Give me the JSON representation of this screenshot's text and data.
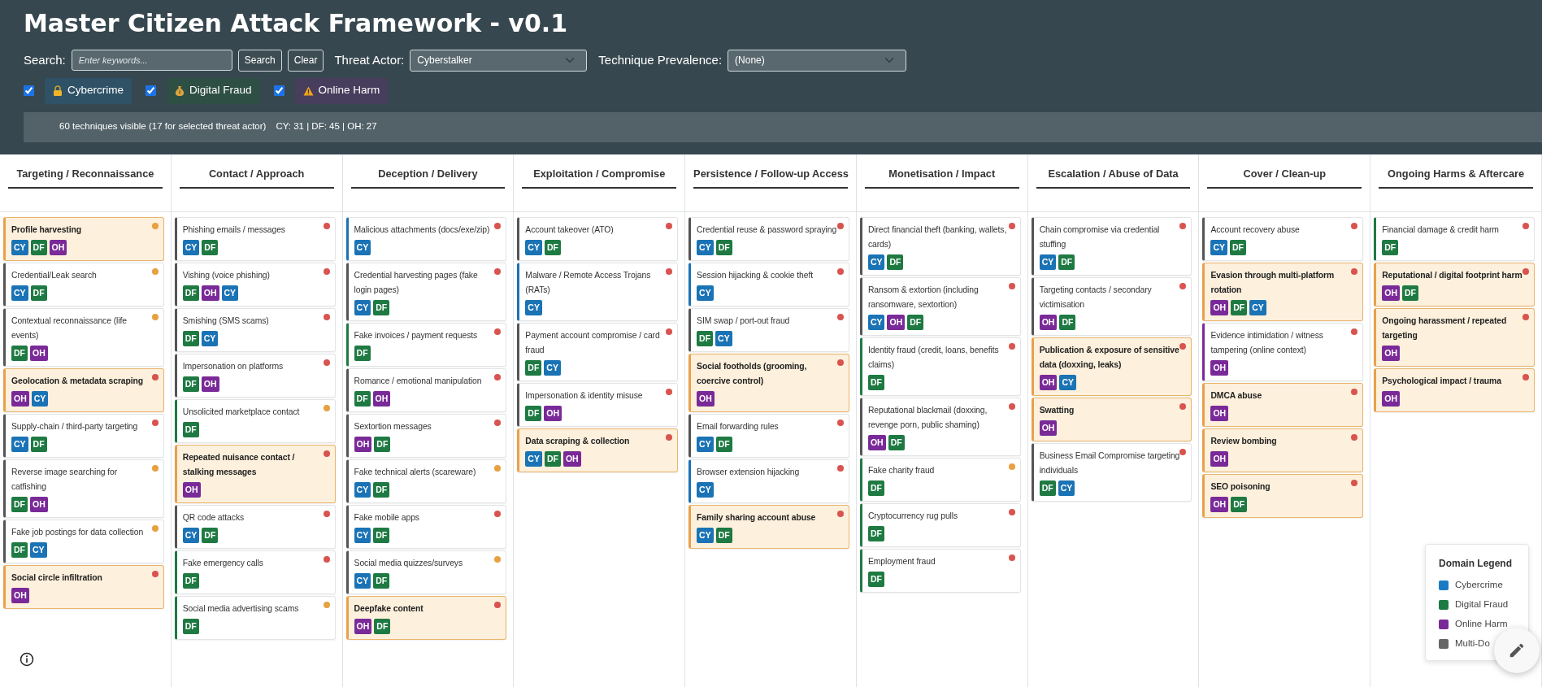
{
  "title": "Master Citizen Attack Framework - v0.1",
  "search": {
    "label": "Search:",
    "placeholder": "Enter keywords...",
    "buttons": [
      "Search",
      "Clear"
    ]
  },
  "threat_actor": {
    "label": "Threat Actor:",
    "value": "Cyberstalker"
  },
  "prevalence": {
    "label": "Technique Prevalence:",
    "value": "(None)"
  },
  "domain_filters": [
    {
      "label": "Cybercrime",
      "checked": true,
      "kind": "lock"
    },
    {
      "label": "Digital Fraud",
      "checked": true,
      "kind": "money"
    },
    {
      "label": "Online Harm",
      "checked": true,
      "kind": "warning"
    }
  ],
  "status_bar": {
    "summary": "60 techniques visible (17 for selected threat actor)",
    "counts": "CY: 31 | DF: 45 | OH: 27"
  },
  "columns": [
    {
      "title": "Targeting / Reconnaissance",
      "cards": [
        {
          "name": "Profile harvesting",
          "highlighted": true,
          "color": "#e8a040",
          "tags": [
            {
              "label": "CY",
              "color": "#1a73b5"
            },
            {
              "label": "DF",
              "color": "#1e7a42"
            },
            {
              "label": "OH",
              "color": "#7a2a98"
            }
          ]
        },
        {
          "name": "Credential/Leak search",
          "highlighted": false,
          "color": "#e8a040",
          "tags": [
            {
              "label": "CY",
              "color": "#1a73b5"
            },
            {
              "label": "DF",
              "color": "#1e7a42"
            }
          ]
        },
        {
          "name": "Contextual reconnaissance (life events)",
          "highlighted": false,
          "color": "#e8a040",
          "tags": [
            {
              "label": "DF",
              "color": "#1e7a42"
            },
            {
              "label": "OH",
              "color": "#7a2a98"
            }
          ]
        },
        {
          "name": "Geolocation & metadata scraping",
          "highlighted": true,
          "color": "#d9534f",
          "tags": [
            {
              "label": "OH",
              "color": "#7a2a98"
            },
            {
              "label": "CY",
              "color": "#1a73b5"
            }
          ]
        },
        {
          "name": "Supply-chain / third-party targeting",
          "highlighted": false,
          "color": "#d9534f",
          "tags": [
            {
              "label": "CY",
              "color": "#1a73b5"
            },
            {
              "label": "DF",
              "color": "#1e7a42"
            }
          ]
        },
        {
          "name": "Reverse image searching for catfishing",
          "highlighted": false,
          "color": "#e8a040",
          "tags": [
            {
              "label": "DF",
              "color": "#1e7a42"
            },
            {
              "label": "OH",
              "color": "#7a2a98"
            }
          ]
        },
        {
          "name": "Fake job postings for data collection",
          "highlighted": false,
          "color": "#e8a040",
          "tags": [
            {
              "label": "DF",
              "color": "#1e7a42"
            },
            {
              "label": "CY",
              "color": "#1a73b5"
            }
          ]
        },
        {
          "name": "Social circle infiltration",
          "highlighted": true,
          "color": "#d9534f",
          "tags": [
            {
              "label": "OH",
              "color": "#7a2a98"
            }
          ]
        }
      ]
    },
    {
      "title": "Contact / Approach",
      "cards": [
        {
          "name": "Phishing emails / messages",
          "highlighted": false,
          "color": "#d9534f",
          "tags": [
            {
              "label": "CY",
              "color": "#1a73b5"
            },
            {
              "label": "DF",
              "color": "#1e7a42"
            }
          ]
        },
        {
          "name": "Vishing (voice phishing)",
          "highlighted": false,
          "color": "#d9534f",
          "tags": [
            {
              "label": "DF",
              "color": "#1e7a42"
            },
            {
              "label": "OH",
              "color": "#7a2a98"
            },
            {
              "label": "CY",
              "color": "#1a73b5"
            }
          ]
        },
        {
          "name": "Smishing (SMS scams)",
          "highlighted": false,
          "color": "#d9534f",
          "tags": [
            {
              "label": "DF",
              "color": "#1e7a42"
            },
            {
              "label": "CY",
              "color": "#1a73b5"
            }
          ]
        },
        {
          "name": "Impersonation on platforms",
          "highlighted": false,
          "color": "#d9534f",
          "tags": [
            {
              "label": "DF",
              "color": "#1e7a42"
            },
            {
              "label": "OH",
              "color": "#7a2a98"
            }
          ]
        },
        {
          "name": "Unsolicited marketplace contact",
          "highlighted": false,
          "color": "#e8a040",
          "tags": [
            {
              "label": "DF",
              "color": "#1e7a42"
            }
          ]
        },
        {
          "name": "Repeated nuisance contact / stalking messages",
          "highlighted": true,
          "color": "#d9534f",
          "tags": [
            {
              "label": "OH",
              "color": "#7a2a98"
            }
          ]
        },
        {
          "name": "QR code attacks",
          "highlighted": false,
          "color": "#d9534f",
          "tags": [
            {
              "label": "CY",
              "color": "#1a73b5"
            },
            {
              "label": "DF",
              "color": "#1e7a42"
            }
          ]
        },
        {
          "name": "Fake emergency calls",
          "highlighted": false,
          "color": "#d9534f",
          "tags": [
            {
              "label": "DF",
              "color": "#1e7a42"
            }
          ]
        },
        {
          "name": "Social media advertising scams",
          "highlighted": false,
          "color": "#e8a040",
          "tags": [
            {
              "label": "DF",
              "color": "#1e7a42"
            }
          ]
        }
      ]
    },
    {
      "title": "Deception / Delivery",
      "cards": [
        {
          "name": "Malicious attachments (docs/exe/zip)",
          "highlighted": false,
          "color": "#d9534f",
          "tags": [
            {
              "label": "CY",
              "color": "#1a73b5"
            }
          ]
        },
        {
          "name": "Credential harvesting pages (fake login pages)",
          "highlighted": false,
          "color": "#d9534f",
          "tags": [
            {
              "label": "CY",
              "color": "#1a73b5"
            },
            {
              "label": "DF",
              "color": "#1e7a42"
            }
          ]
        },
        {
          "name": "Fake invoices / payment requests",
          "highlighted": false,
          "color": "#d9534f",
          "tags": [
            {
              "label": "DF",
              "color": "#1e7a42"
            }
          ]
        },
        {
          "name": "Romance / emotional manipulation",
          "highlighted": false,
          "color": "#d9534f",
          "tags": [
            {
              "label": "DF",
              "color": "#1e7a42"
            },
            {
              "label": "OH",
              "color": "#7a2a98"
            }
          ]
        },
        {
          "name": "Sextortion messages",
          "highlighted": false,
          "color": "#d9534f",
          "tags": [
            {
              "label": "OH",
              "color": "#7a2a98"
            },
            {
              "label": "DF",
              "color": "#1e7a42"
            }
          ]
        },
        {
          "name": "Fake technical alerts (scareware)",
          "highlighted": false,
          "color": "#e8a040",
          "tags": [
            {
              "label": "CY",
              "color": "#1a73b5"
            },
            {
              "label": "DF",
              "color": "#1e7a42"
            }
          ]
        },
        {
          "name": "Fake mobile apps",
          "highlighted": false,
          "color": "#d9534f",
          "tags": [
            {
              "label": "CY",
              "color": "#1a73b5"
            },
            {
              "label": "DF",
              "color": "#1e7a42"
            }
          ]
        },
        {
          "name": "Social media quizzes/surveys",
          "highlighted": false,
          "color": "#e8a040",
          "tags": [
            {
              "label": "CY",
              "color": "#1a73b5"
            },
            {
              "label": "DF",
              "color": "#1e7a42"
            }
          ]
        },
        {
          "name": "Deepfake content",
          "highlighted": true,
          "color": "#d9534f",
          "tags": [
            {
              "label": "OH",
              "color": "#7a2a98"
            },
            {
              "label": "DF",
              "color": "#1e7a42"
            }
          ]
        }
      ]
    },
    {
      "title": "Exploitation / Compromise",
      "cards": [
        {
          "name": "Account takeover (ATO)",
          "highlighted": false,
          "color": "#d9534f",
          "tags": [
            {
              "label": "CY",
              "color": "#1a73b5"
            },
            {
              "label": "DF",
              "color": "#1e7a42"
            }
          ]
        },
        {
          "name": "Malware / Remote Access Trojans (RATs)",
          "highlighted": false,
          "color": "#d9534f",
          "tags": [
            {
              "label": "CY",
              "color": "#1a73b5"
            }
          ]
        },
        {
          "name": "Payment account compromise / card fraud",
          "highlighted": false,
          "color": "#d9534f",
          "tags": [
            {
              "label": "DF",
              "color": "#1e7a42"
            },
            {
              "label": "CY",
              "color": "#1a73b5"
            }
          ]
        },
        {
          "name": "Impersonation & identity misuse",
          "highlighted": false,
          "color": "#d9534f",
          "tags": [
            {
              "label": "DF",
              "color": "#1e7a42"
            },
            {
              "label": "OH",
              "color": "#7a2a98"
            }
          ]
        },
        {
          "name": "Data scraping & collection",
          "highlighted": true,
          "color": "#d9534f",
          "tags": [
            {
              "label": "CY",
              "color": "#1a73b5"
            },
            {
              "label": "DF",
              "color": "#1e7a42"
            },
            {
              "label": "OH",
              "color": "#7a2a98"
            }
          ]
        }
      ]
    },
    {
      "title": "Persistence / Follow-up Access",
      "cards": [
        {
          "name": "Credential reuse & password spraying",
          "highlighted": false,
          "color": "#d9534f",
          "tags": [
            {
              "label": "CY",
              "color": "#1a73b5"
            },
            {
              "label": "DF",
              "color": "#1e7a42"
            }
          ]
        },
        {
          "name": "Session hijacking & cookie theft",
          "highlighted": false,
          "color": "#d9534f",
          "tags": [
            {
              "label": "CY",
              "color": "#1a73b5"
            }
          ]
        },
        {
          "name": "SIM swap / port-out fraud",
          "highlighted": false,
          "color": "#d9534f",
          "tags": [
            {
              "label": "DF",
              "color": "#1e7a42"
            },
            {
              "label": "CY",
              "color": "#1a73b5"
            }
          ]
        },
        {
          "name": "Social footholds (grooming, coercive control)",
          "highlighted": true,
          "color": "#d9534f",
          "tags": [
            {
              "label": "OH",
              "color": "#7a2a98"
            }
          ]
        },
        {
          "name": "Email forwarding rules",
          "highlighted": false,
          "color": "#d9534f",
          "tags": [
            {
              "label": "CY",
              "color": "#1a73b5"
            },
            {
              "label": "DF",
              "color": "#1e7a42"
            }
          ]
        },
        {
          "name": "Browser extension hijacking",
          "highlighted": false,
          "color": "#d9534f",
          "tags": [
            {
              "label": "CY",
              "color": "#1a73b5"
            }
          ]
        },
        {
          "name": "Family sharing account abuse",
          "highlighted": true,
          "color": "#d9534f",
          "tags": [
            {
              "label": "CY",
              "color": "#1a73b5"
            },
            {
              "label": "DF",
              "color": "#1e7a42"
            }
          ]
        }
      ]
    },
    {
      "title": "Monetisation / Impact",
      "cards": [
        {
          "name": "Direct financial theft (banking, wallets, cards)",
          "highlighted": false,
          "color": "#d9534f",
          "tags": [
            {
              "label": "CY",
              "color": "#1a73b5"
            },
            {
              "label": "DF",
              "color": "#1e7a42"
            }
          ]
        },
        {
          "name": "Ransom & extortion (including ransomware, sextortion)",
          "highlighted": false,
          "color": "#d9534f",
          "tags": [
            {
              "label": "CY",
              "color": "#1a73b5"
            },
            {
              "label": "OH",
              "color": "#7a2a98"
            },
            {
              "label": "DF",
              "color": "#1e7a42"
            }
          ]
        },
        {
          "name": "Identity fraud (credit, loans, benefits claims)",
          "highlighted": false,
          "color": "#d9534f",
          "tags": [
            {
              "label": "DF",
              "color": "#1e7a42"
            }
          ]
        },
        {
          "name": "Reputational blackmail (doxxing, revenge porn, public shaming)",
          "highlighted": false,
          "color": "#d9534f",
          "tags": [
            {
              "label": "OH",
              "color": "#7a2a98"
            },
            {
              "label": "DF",
              "color": "#1e7a42"
            }
          ]
        },
        {
          "name": "Fake charity fraud",
          "highlighted": false,
          "color": "#e8a040",
          "tags": [
            {
              "label": "DF",
              "color": "#1e7a42"
            }
          ]
        },
        {
          "name": "Cryptocurrency rug pulls",
          "highlighted": false,
          "color": "#d9534f",
          "tags": [
            {
              "label": "DF",
              "color": "#1e7a42"
            }
          ]
        },
        {
          "name": "Employment fraud",
          "highlighted": false,
          "color": "#d9534f",
          "tags": [
            {
              "label": "DF",
              "color": "#1e7a42"
            }
          ]
        }
      ]
    },
    {
      "title": "Escalation / Abuse of Data",
      "cards": [
        {
          "name": "Chain compromise via credential stuffing",
          "highlighted": false,
          "color": "#d9534f",
          "tags": [
            {
              "label": "CY",
              "color": "#1a73b5"
            },
            {
              "label": "DF",
              "color": "#1e7a42"
            }
          ]
        },
        {
          "name": "Targeting contacts / secondary victimisation",
          "highlighted": false,
          "color": "#d9534f",
          "tags": [
            {
              "label": "OH",
              "color": "#7a2a98"
            },
            {
              "label": "DF",
              "color": "#1e7a42"
            }
          ]
        },
        {
          "name": "Publication & exposure of sensitive data (doxxing, leaks)",
          "highlighted": true,
          "color": "#d9534f",
          "tags": [
            {
              "label": "OH",
              "color": "#7a2a98"
            },
            {
              "label": "CY",
              "color": "#1a73b5"
            }
          ]
        },
        {
          "name": "Swatting",
          "highlighted": true,
          "color": "#d9534f",
          "tags": [
            {
              "label": "OH",
              "color": "#7a2a98"
            }
          ]
        },
        {
          "name": "Business Email Compromise targeting individuals",
          "highlighted": false,
          "color": "#d9534f",
          "tags": [
            {
              "label": "DF",
              "color": "#1e7a42"
            },
            {
              "label": "CY",
              "color": "#1a73b5"
            }
          ]
        }
      ]
    },
    {
      "title": "Cover / Clean-up",
      "cards": [
        {
          "name": "Account recovery abuse",
          "highlighted": false,
          "color": "#d9534f",
          "tags": [
            {
              "label": "CY",
              "color": "#1a73b5"
            },
            {
              "label": "DF",
              "color": "#1e7a42"
            }
          ]
        },
        {
          "name": "Evasion through multi-platform rotation",
          "highlighted": true,
          "color": "#d9534f",
          "tags": [
            {
              "label": "OH",
              "color": "#7a2a98"
            },
            {
              "label": "DF",
              "color": "#1e7a42"
            },
            {
              "label": "CY",
              "color": "#1a73b5"
            }
          ]
        },
        {
          "name": "Evidence intimidation / witness tampering (online context)",
          "highlighted": false,
          "color": "#d9534f",
          "tags": [
            {
              "label": "OH",
              "color": "#7a2a98"
            }
          ]
        },
        {
          "name": "DMCA abuse",
          "highlighted": true,
          "color": "#d9534f",
          "tags": [
            {
              "label": "OH",
              "color": "#7a2a98"
            }
          ]
        },
        {
          "name": "Review bombing",
          "highlighted": true,
          "color": "#d9534f",
          "tags": [
            {
              "label": "OH",
              "color": "#7a2a98"
            }
          ]
        },
        {
          "name": "SEO poisoning",
          "highlighted": true,
          "color": "#d9534f",
          "tags": [
            {
              "label": "OH",
              "color": "#7a2a98"
            },
            {
              "label": "DF",
              "color": "#1e7a42"
            }
          ]
        }
      ]
    },
    {
      "title": "Ongoing Harms & Aftercare",
      "cards": [
        {
          "name": "Financial damage & credit harm",
          "highlighted": false,
          "color": "#d9534f",
          "tags": [
            {
              "label": "DF",
              "color": "#1e7a42"
            }
          ]
        },
        {
          "name": "Reputational / digital footprint harm",
          "highlighted": true,
          "color": "#d9534f",
          "tags": [
            {
              "label": "OH",
              "color": "#7a2a98"
            },
            {
              "label": "DF",
              "color": "#1e7a42"
            }
          ]
        },
        {
          "name": "Ongoing harassment / repeated targeting",
          "highlighted": true,
          "color": "#d9534f",
          "tags": [
            {
              "label": "OH",
              "color": "#7a2a98"
            }
          ]
        },
        {
          "name": "Psychological impact / trauma",
          "highlighted": true,
          "color": "#d9534f",
          "tags": [
            {
              "label": "OH",
              "color": "#7a2a98"
            }
          ]
        }
      ]
    }
  ],
  "legend": {
    "title": "Domain Legend",
    "items": [
      {
        "label": "Cybercrime",
        "color": "#1a7bc4"
      },
      {
        "label": "Digital Fraud",
        "color": "#1e7a45"
      },
      {
        "label": "Online Harm",
        "color": "#7a2a98"
      },
      {
        "label": "Multi-Do",
        "color": "#666666"
      }
    ]
  }
}
